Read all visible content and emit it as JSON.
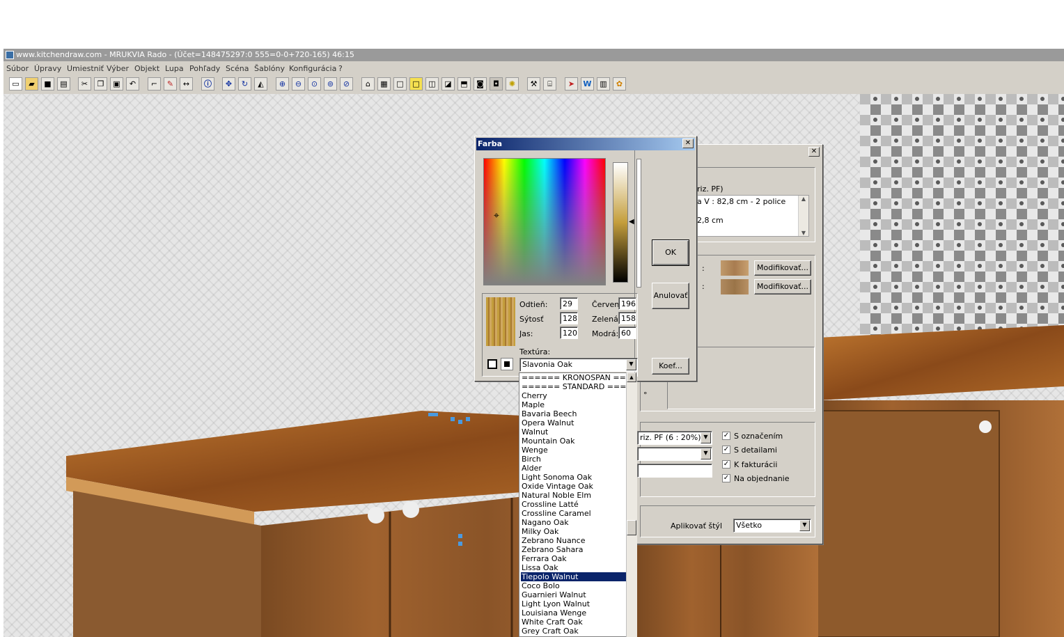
{
  "window": {
    "title": "www.kitchendraw.com - MRUKVIA Rado - (Účet=148475297:0 555=0-0+720-165) 46:15"
  },
  "menu": [
    "Súbor",
    "Úpravy",
    "Umiestniť",
    "Výber",
    "Objekt",
    "Lupa",
    "Pohľady",
    "Scéna",
    "Šablóny",
    "Konfigurácia",
    "?"
  ],
  "toolbar": {
    "icons": [
      "new-icon",
      "open-icon",
      "save-icon",
      "print-icon",
      "cut-icon",
      "copy-icon",
      "paste-icon",
      "undo-icon",
      "stairs-icon",
      "paint-icon",
      "dimension-icon",
      "info-icon",
      "move-icon",
      "rotate-icon",
      "mirror-icon",
      "zoom-in-icon",
      "zoom-out-icon",
      "zoom-window-icon",
      "zoom-all-icon",
      "zoom-previous-icon",
      "render-icon",
      "layout-icon",
      "view-plan-icon",
      "view-elevation-icon",
      "view-3d-icon",
      "view-box-icon",
      "view-perspective-icon",
      "camera-icon",
      "photo-icon",
      "light-icon",
      "tools-icon",
      "shop-icon",
      "export-icon",
      "word-icon",
      "catalog-icon",
      "palette-icon"
    ]
  },
  "color_dialog": {
    "title": "Farba",
    "close": "✕",
    "labels": {
      "hue": "Odtieň:",
      "sat": "Sýtosť",
      "lum": "Jas:",
      "red": "Červená",
      "green": "Zelená:",
      "blue": "Modrá:",
      "texture": "Textúra:"
    },
    "values": {
      "hue": "29",
      "sat": "128",
      "lum": "120",
      "red": "196",
      "green": "158",
      "blue": "60"
    },
    "buttons": {
      "ok": "OK",
      "cancel": "Anulovať",
      "coef": "Koef..."
    },
    "texture_selected": "Slavonia Oak",
    "swatch_color": "#c49e3c",
    "texture_list": [
      "====== KRONOSPAN ======",
      "====== STANDARD =======",
      "Cherry",
      "Maple",
      "Bavaria Beech",
      "Opera Walnut",
      "Walnut",
      "Mountain Oak",
      "Wenge",
      "Birch",
      "Alder",
      "Light Sonoma Oak",
      "Oxide Vintage Oak",
      "Natural Noble Elm",
      "Crossline Latté",
      "Crossline Caramel",
      "Nagano Oak",
      "Milky Oak",
      "Zebrano Nuance",
      "Zebrano Sahara",
      "Ferrara Oak",
      "Lissa Oak",
      "Tiepolo Walnut",
      "Coco Bolo",
      "Guarnieri Walnut",
      "Light Lyon Walnut",
      "Louisiana Wenge",
      "White Craft Oak",
      "Grey Craft Oak"
    ],
    "texture_list_selected_index": 22
  },
  "back_dialog": {
    "close": "✕",
    "desc_label": "riz. PF)",
    "desc_line1": "a V : 82,8 cm - 2 police",
    "desc_line2": "2,8 cm",
    "colon1": ":",
    "colon2": ":",
    "modify1": "Modifikovať...",
    "modify2": "Modifikovať...",
    "degree": "°",
    "style_select": "riz. PF (6 : 20%)",
    "checks": [
      {
        "label": "S označením",
        "checked": true
      },
      {
        "label": "S detailami",
        "checked": true
      },
      {
        "label": "K fakturácii",
        "checked": true
      },
      {
        "label": "Na objednanie",
        "checked": true
      }
    ],
    "apply_style_label": "Aplikovať štýl",
    "apply_style_value": "Všetko",
    "check_mark": "✓"
  },
  "colors": {
    "accent_caption": "#0a246a",
    "selection": "#0a246a",
    "dialog_bg": "#d4d0c8"
  }
}
